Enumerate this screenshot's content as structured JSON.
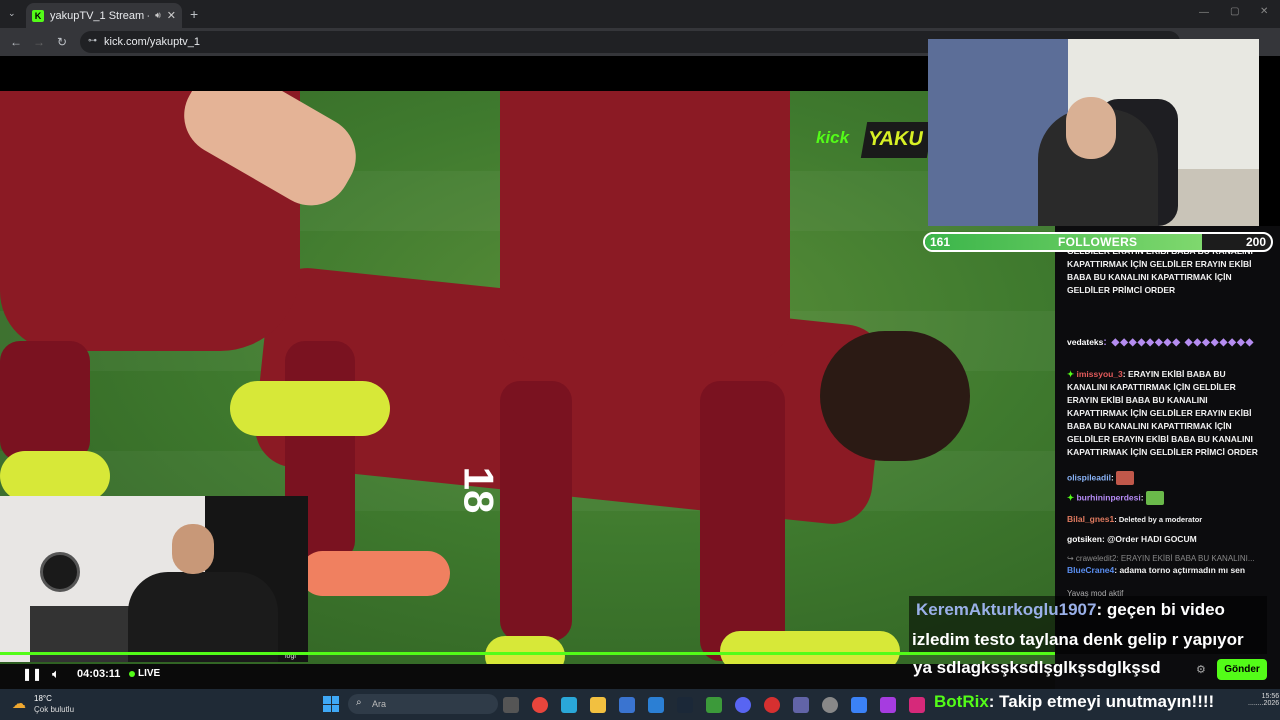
{
  "browser": {
    "tab_title": "yakupTV_1 Stream - Watch",
    "url": "kick.com/yakuptv_1",
    "favicon_letter": "K"
  },
  "stream": {
    "kick_logo": "kick",
    "brand_badge": "YAKU",
    "jersey_number": "18",
    "cam2_label": "logi"
  },
  "followers": {
    "current": "161",
    "label": "FOLLOWERS",
    "goal": "200",
    "progress_fraction": 0.8
  },
  "chat": {
    "messages": [
      {
        "text": "BABA BU KANALINI KAPATTIRMAK İÇİN GELDİLER ERAYIN EKİBİ BABA BU KANALINI KAPATTIRMAK İÇİN GELDİLER ERAYIN EKİBİ BABA BU KANALINI KAPATTIRMAK İÇİN GELDİLER PRİMCİ ORDER"
      },
      {
        "user": "vedateks",
        "text": ": ◆◆◆◆◆◆◆◆ ◆◆◆◆◆◆◆◆"
      },
      {
        "user": "imissyou_3",
        "text": ": ERAYIN EKİBİ BABA BU KANALINI KAPATTIRMAK İÇİN GELDİLER ERAYIN EKİBİ BABA BU KANALINI KAPATTIRMAK İÇİN GELDİLER ERAYIN EKİBİ BABA BU KANALINI KAPATTIRMAK İÇİN GELDİLER ERAYIN EKİBİ BABA BU KANALINI KAPATTIRMAK İÇİN GELDİLER PRİMCİ ORDER"
      },
      {
        "user": "olispileadil",
        "text": ":"
      },
      {
        "user": "burhininperdesi",
        "text": ":"
      },
      {
        "user": "Bilal_gnes1",
        "text": ": Deleted by a moderator"
      },
      {
        "user": "gotsiken",
        "text": ": @Order HADI GOCUM"
      },
      {
        "user": "",
        "text": "↪ craweledit2: ERAYIN EKİBİ BABA BU KANALINI..."
      },
      {
        "user": "BlueCrane4",
        "text": ": adama torno açtırmadın mı sen"
      },
      {
        "user": "",
        "text": "Yavaş mod aktif"
      }
    ]
  },
  "overlay": {
    "user": "KeremAkturkoglu1907",
    "line1_rest": ": geçen bi video",
    "line2": "izledim testo taylana denk gelip r yapıyor",
    "line3": "ya sdlagksşksdlşglkşsdglkşsd"
  },
  "botrix": {
    "name": "BotRix",
    "message": ": Takip etmeyi unutmayın!!!!"
  },
  "player": {
    "time": "04:03:11",
    "live": "LIVE",
    "send_label": "Gönder"
  },
  "taskbar": {
    "temp": "18°C",
    "weather": "Çok bulutlu",
    "search_placeholder": "Ara",
    "clock_time": "15:56",
    "clock_date": "........2026"
  },
  "colors": {
    "kick_green": "#53fc18",
    "jersey_red": "#8b1a24",
    "pitch_green": "#3f7a2e"
  }
}
